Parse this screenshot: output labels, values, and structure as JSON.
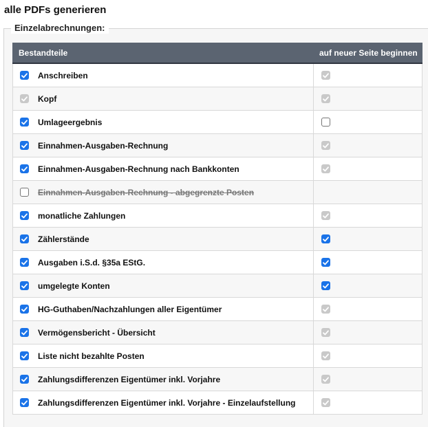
{
  "page": {
    "title": "alle PDFs generieren"
  },
  "section": {
    "legend": "Einzelabrechnungen:"
  },
  "table": {
    "headers": {
      "parts": "Bestandteile",
      "new_page": "auf neuer Seite beginnen"
    },
    "rows": [
      {
        "label": "Anschreiben",
        "checked": "on",
        "new_page": "disabled-on",
        "struck": false
      },
      {
        "label": "Kopf",
        "checked": "disabled-on",
        "new_page": "disabled-on",
        "struck": false
      },
      {
        "label": "Umlageergebnis",
        "checked": "on",
        "new_page": "off",
        "struck": false
      },
      {
        "label": "Einnahmen-Ausgaben-Rechnung",
        "checked": "on",
        "new_page": "disabled-on",
        "struck": false
      },
      {
        "label": "Einnahmen-Ausgaben-Rechnung nach Bankkonten",
        "checked": "on",
        "new_page": "disabled-on",
        "struck": false
      },
      {
        "label": "Einnahmen-Ausgaben-Rechnung - abgegrenzte Posten",
        "checked": "off",
        "new_page": "none",
        "struck": true
      },
      {
        "label": "monatliche Zahlungen",
        "checked": "on",
        "new_page": "disabled-on",
        "struck": false
      },
      {
        "label": "Zählerstände",
        "checked": "on",
        "new_page": "on",
        "struck": false
      },
      {
        "label": "Ausgaben i.S.d. §35a EStG.",
        "checked": "on",
        "new_page": "on",
        "struck": false
      },
      {
        "label": "umgelegte Konten",
        "checked": "on",
        "new_page": "on",
        "struck": false
      },
      {
        "label": "HG-Guthaben/Nachzahlungen aller Eigentümer",
        "checked": "on",
        "new_page": "disabled-on",
        "struck": false
      },
      {
        "label": "Vermögensbericht - Übersicht",
        "checked": "on",
        "new_page": "disabled-on",
        "struck": false
      },
      {
        "label": "Liste nicht bezahlte Posten",
        "checked": "on",
        "new_page": "disabled-on",
        "struck": false
      },
      {
        "label": "Zahlungsdifferenzen Eigentümer inkl. Vorjahre",
        "checked": "on",
        "new_page": "disabled-on",
        "struck": false
      },
      {
        "label": "Zahlungsdifferenzen Eigentümer inkl. Vorjahre - Einzelaufstellung",
        "checked": "on",
        "new_page": "disabled-on",
        "struck": false
      }
    ]
  },
  "colors": {
    "checkbox_on": "#1a73e8",
    "checkbox_disabled": "#c9c9c9",
    "header_bg": "#5b6471"
  }
}
